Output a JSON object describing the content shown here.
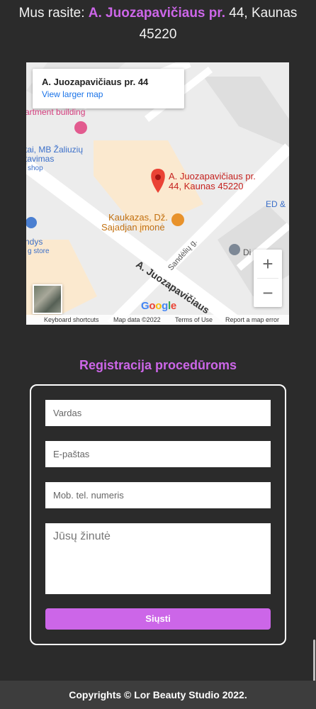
{
  "address": {
    "prefix": "Mus rasite: ",
    "street": "A. Juozapavičiaus pr.",
    "rest": " 44, Kaunas 45220"
  },
  "map": {
    "card_title": "A. Juozapavičiaus pr. 44",
    "card_link": "View larger map",
    "labels": {
      "apartment": "artment building",
      "shop1_line1": "tai, MB Žaliuzių",
      "shop1_line2": "tavimas",
      "shop1_line3": "shop",
      "shop2_line1": "ndys",
      "shop2_line2": "g store",
      "pin_line1": "A. Juozapavičiaus pr.",
      "pin_line2": "44, Kaunas 45220",
      "ed": "ED &",
      "restaurant_line1": "Kaukazas, Dž.",
      "restaurant_line2": "Sajadjan įmonė",
      "sandeliu": "Sandėlių g.",
      "di": "Di",
      "street_big": "A. Juozapavičiaus"
    },
    "zoom_in": "+",
    "zoom_out": "−",
    "logo": "Google",
    "footer": {
      "shortcuts": "Keyboard shortcuts",
      "data": "Map data ©2022",
      "terms": "Terms of Use",
      "report": "Report a map error"
    }
  },
  "form": {
    "title": "Registracija procedūroms",
    "name_placeholder": "Vardas",
    "email_placeholder": "E-paštas",
    "phone_placeholder": "Mob. tel. numeris",
    "message_placeholder": "Jūsų žinutė",
    "submit_label": "Siųsti"
  },
  "footer": {
    "copyright": "Copyrights © Lor Beauty Studio 2022."
  },
  "colors": {
    "accent": "#cc66e8",
    "background": "#2b2b2b",
    "footer_bg": "#3d3d3d"
  }
}
